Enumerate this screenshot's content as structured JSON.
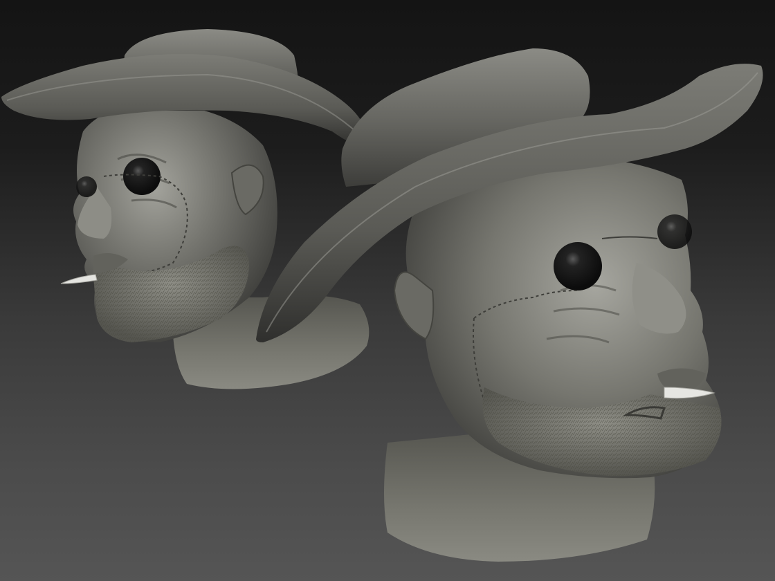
{
  "scene": {
    "background_top": "#141414",
    "background_bottom": "#555555",
    "material_color": "#6e6e69",
    "material_dark": "#3a3a37",
    "material_light": "#9a9a93",
    "eye_color": "#161616",
    "models": [
      {
        "name": "cowboy-head-bust-left",
        "view": "three-quarter-left"
      },
      {
        "name": "cowboy-head-bust-right",
        "view": "three-quarter-right"
      }
    ]
  }
}
